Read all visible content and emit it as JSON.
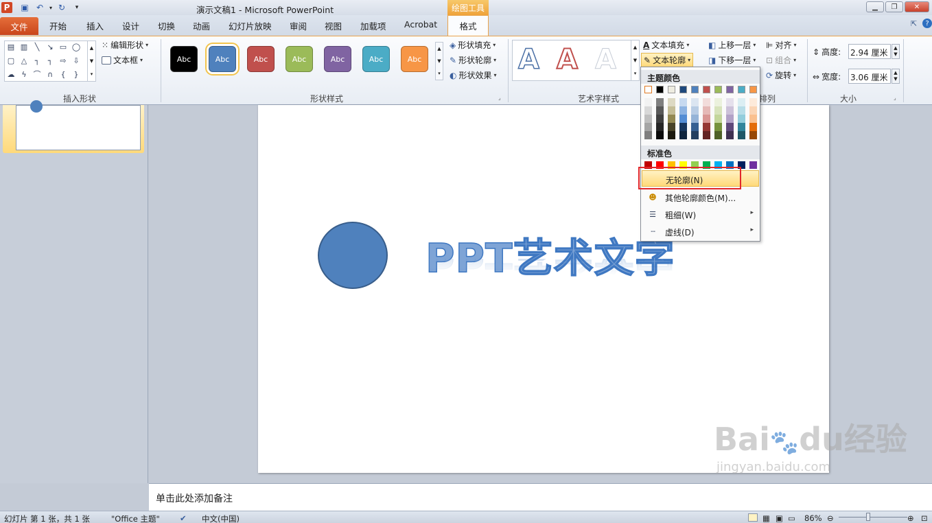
{
  "titlebar": {
    "title": "演示文稿1  -  Microsoft PowerPoint",
    "tool_header": "绘图工具",
    "app_icon": "P",
    "quick_access": [
      "save-icon",
      "undo-icon",
      "redo-icon",
      "customize-icon"
    ]
  },
  "tabs": {
    "file": "文件",
    "items": [
      "开始",
      "插入",
      "设计",
      "切换",
      "动画",
      "幻灯片放映",
      "审阅",
      "视图",
      "加载项",
      "Acrobat"
    ],
    "format": "格式"
  },
  "ribbon": {
    "insert_shapes": {
      "edit_shape": "编辑形状",
      "text_box": "文本框",
      "label": "插入形状"
    },
    "shape_styles": {
      "label": "形状样式",
      "sample_text": "Abc",
      "styles": [
        {
          "color": "#000000",
          "border": "#333333"
        },
        {
          "color": "#4f81bd",
          "border": "#385d8a"
        },
        {
          "color": "#c0504d",
          "border": "#8c3836"
        },
        {
          "color": "#9bbb59",
          "border": "#71893f"
        },
        {
          "color": "#8064a2",
          "border": "#5c4776"
        },
        {
          "color": "#4bacc6",
          "border": "#357d91"
        },
        {
          "color": "#f79646",
          "border": "#b66d31"
        }
      ],
      "fill": "形状填充",
      "outline": "形状轮廓",
      "effects": "形状效果"
    },
    "wordart": {
      "label": "艺术字样式",
      "sample": "A",
      "text_fill": "文本填充",
      "text_outline": "文本轮廓"
    },
    "arrange": {
      "label": "排列",
      "bring_forward": "上移一层",
      "send_backward": "下移一层",
      "align": "对齐",
      "group": "组合",
      "rotate": "旋转"
    },
    "size": {
      "label": "大小",
      "height_label": "高度:",
      "height_value": "2.94 厘米",
      "width_label": "宽度:",
      "width_value": "3.06 厘米"
    }
  },
  "slide": {
    "art_text": "PPT艺术文字",
    "shape_color": "#4f81bd"
  },
  "notes": {
    "placeholder": "单击此处添加备注"
  },
  "status": {
    "slide_info": "幻灯片 第 1 张，共 1 张",
    "theme": "\"Office 主题\"",
    "language": "中文(中国)",
    "zoom": "86%"
  },
  "dropdown": {
    "theme_colors_header": "主题颜色",
    "standard_colors_header": "标准色",
    "theme_top_row": [
      "#ffffff",
      "#000000",
      "#eeece1",
      "#1f497d",
      "#4f81bd",
      "#c0504d",
      "#9bbb59",
      "#8064a2",
      "#4bacc6",
      "#f79646"
    ],
    "theme_shades": [
      [
        "#f2f2f2",
        "#7f7f7f",
        "#ddd9c3",
        "#c6d9f0",
        "#dbe5f1",
        "#f2dcdb",
        "#ebf1dd",
        "#e5e0ec",
        "#dbeef3",
        "#fdeada"
      ],
      [
        "#d8d8d8",
        "#595959",
        "#c4bd97",
        "#8db3e2",
        "#b8cce4",
        "#e5b9b7",
        "#d7e3bc",
        "#ccc1d9",
        "#b7dde8",
        "#fbd5b5"
      ],
      [
        "#bfbfbf",
        "#3f3f3f",
        "#938953",
        "#548dd4",
        "#95b3d7",
        "#d99694",
        "#c3d69b",
        "#b2a2c7",
        "#92cddc",
        "#fac08f"
      ],
      [
        "#a5a5a5",
        "#262626",
        "#494429",
        "#17365d",
        "#366092",
        "#953734",
        "#76923c",
        "#5f497a",
        "#31859b",
        "#e36c09"
      ],
      [
        "#7f7f7f",
        "#0c0c0c",
        "#1d1b10",
        "#0f243e",
        "#244061",
        "#632423",
        "#4f6128",
        "#3f3151",
        "#205867",
        "#974806"
      ]
    ],
    "standard_colors": [
      "#c00000",
      "#ff0000",
      "#ffc000",
      "#ffff00",
      "#92d050",
      "#00b050",
      "#00b0f0",
      "#0070c0",
      "#002060",
      "#7030a0"
    ],
    "no_outline": "无轮廓(N)",
    "more_colors": "其他轮廓颜色(M)...",
    "weight": "粗细(W)",
    "dashes": "虚线(D)"
  },
  "watermark": {
    "brand": "Bai",
    "brand2": "du",
    "suffix": "经验",
    "url": "jingyan.baidu.com"
  }
}
